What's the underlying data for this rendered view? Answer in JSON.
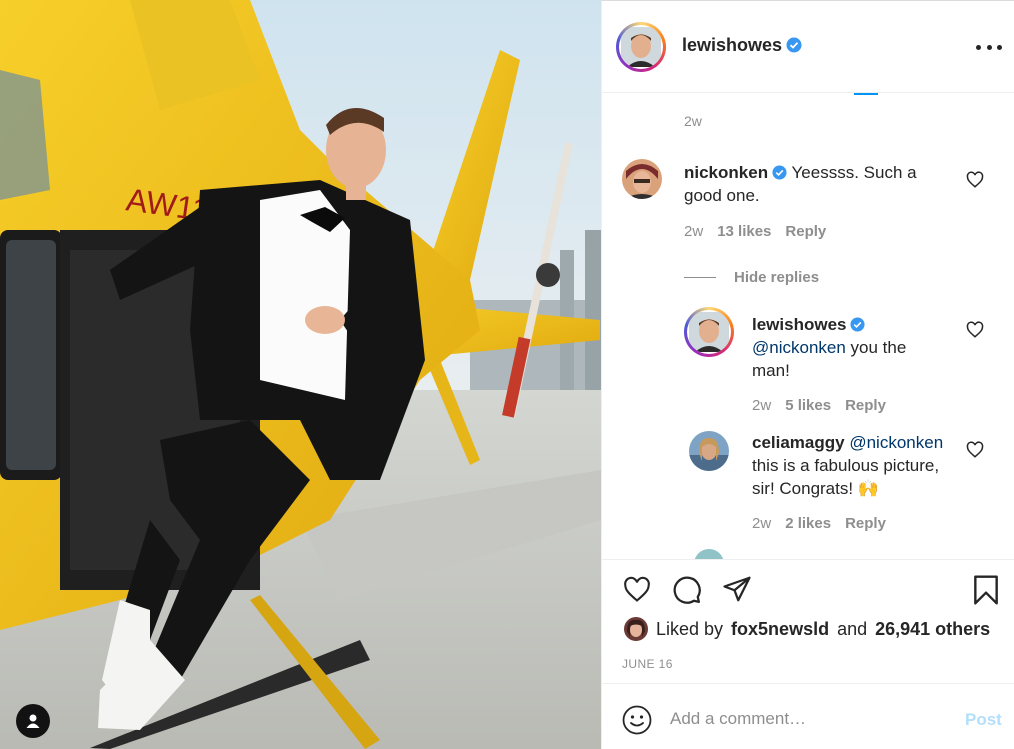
{
  "post": {
    "author": "lewishowes",
    "more_icon": "more-horizontal-icon",
    "verified_icon": "verified-badge-icon"
  },
  "comments": {
    "top_time": "2w",
    "items": [
      {
        "username": "nickonken",
        "verified": true,
        "text": "Yeessss. Such a good one.",
        "line1": "Yeessss. Such a",
        "line2": "good one.",
        "time": "2w",
        "likes": "13 likes",
        "reply": "Reply"
      }
    ],
    "hide_replies": "Hide replies",
    "replies": [
      {
        "username": "lewishowes",
        "verified": true,
        "mention": "@nickonken",
        "line1_rest": "you the",
        "line2": "man!",
        "time": "2w",
        "likes": "5 likes",
        "reply": "Reply"
      },
      {
        "username": "celiamaggy",
        "verified": false,
        "mention": "@nickonken",
        "line2": "this is a fabulous picture,",
        "line3": "sir! Congrats! 🙌",
        "time": "2w",
        "likes": "2 likes",
        "reply": "Reply"
      }
    ]
  },
  "actions": {
    "like_icon": "heart-icon",
    "comment_icon": "comment-icon",
    "share_icon": "paper-plane-icon",
    "save_icon": "bookmark-icon",
    "liked_by_prefix": "Liked by",
    "liked_by_user": "fox5newsld",
    "liked_by_and": "and",
    "liked_by_others": "26,941 others",
    "date": "JUNE 16"
  },
  "comment_box": {
    "placeholder": "Add a comment…",
    "post_label": "Post"
  },
  "colors": {
    "accent": "#0095f6",
    "helicopter": "#f2c21a",
    "tuxedo": "#141414"
  }
}
